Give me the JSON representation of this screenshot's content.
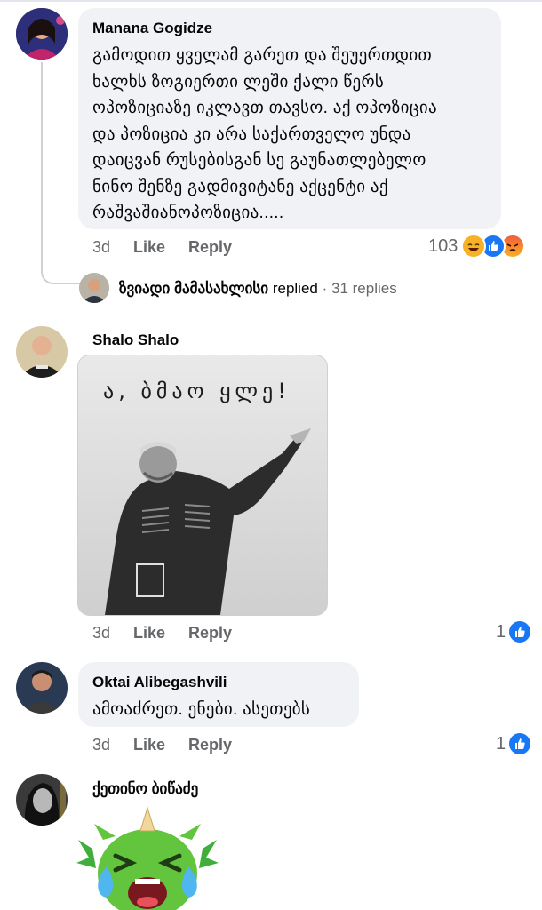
{
  "comments": [
    {
      "author": "Manana Gogidze",
      "lines": [
        "გამოდით ყველამ გარეთ და შეუერთდით",
        "ხალხს ზოგიერთი ლეში ქალი წერს",
        "ოპოზიციაზე იკლავთ თავსო. აქ ოპოზიცია",
        "და პოზიცია კი არა საქართველო უნდა",
        "დაიცვან რუსებისგან სე გაუნათლებელო",
        "ნინო შენზე გადმივიტანე აქცენტი აქ",
        "რაშვაშიანოპოზიცია....."
      ],
      "time": "3d",
      "like_label": "Like",
      "reply_label": "Reply",
      "reaction_count": "103",
      "reactions": [
        "haha-icon",
        "like-icon",
        "angry-icon"
      ]
    },
    {
      "author": "Shalo Shalo",
      "image_caption": "ა, ბმაო ყლე!",
      "time": "3d",
      "like_label": "Like",
      "reply_label": "Reply",
      "reaction_count": "1",
      "reactions": [
        "like-icon"
      ]
    },
    {
      "author": "Oktai Alibegashvili",
      "text": "ამოაძრეთ. ენები. ასეთებს",
      "time": "3d",
      "like_label": "Like",
      "reply_label": "Reply",
      "reaction_count": "1",
      "reactions": [
        "like-icon"
      ]
    },
    {
      "author": "ქეთინო ბიწაძე",
      "sticker": "crying-green-monster-sticker"
    }
  ],
  "reply_thread": {
    "replier": "ზვიადი მამასახლისი",
    "replied_label": "replied",
    "separator": "·",
    "count_label": "31 replies"
  },
  "colors": {
    "bubble": "#f0f2f5",
    "meta_text": "#65676b",
    "like_blue": "#1877f2"
  }
}
